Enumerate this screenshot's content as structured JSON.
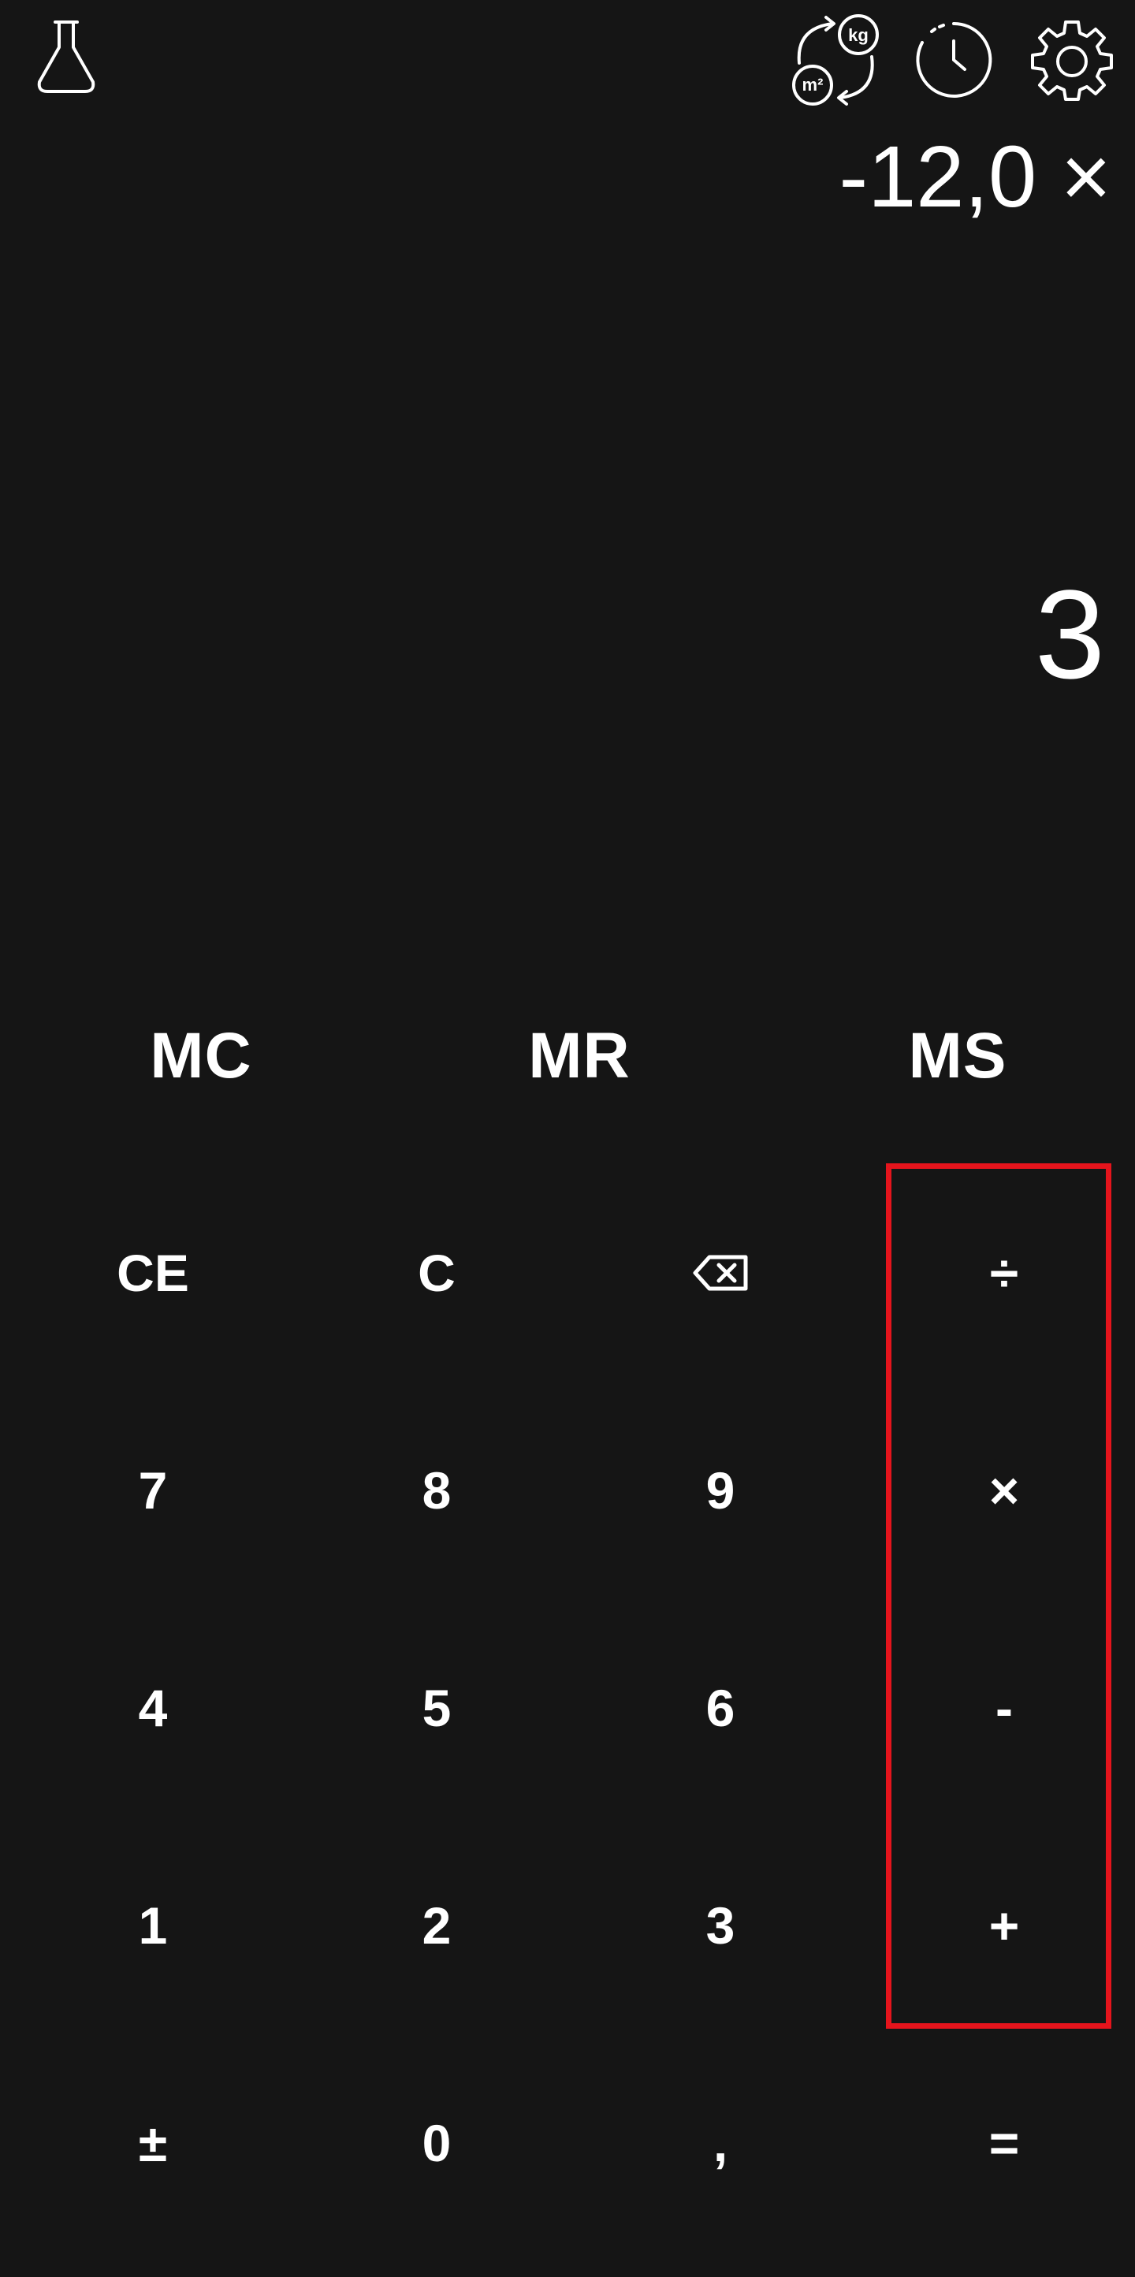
{
  "topbar": {
    "icons": [
      "flask-icon",
      "unit-converter-icon",
      "history-clock-icon",
      "settings-gear-icon"
    ],
    "unit_converter_labels": {
      "top": "kg",
      "bottom": "m²"
    }
  },
  "display": {
    "expression": "-12,0 ×",
    "result": "3"
  },
  "memory": {
    "mc": "MC",
    "mr": "MR",
    "ms": "MS"
  },
  "keys": {
    "ce": "CE",
    "c": "C",
    "backspace": "backspace-icon",
    "divide": "÷",
    "k7": "7",
    "k8": "8",
    "k9": "9",
    "multiply": "×",
    "k4": "4",
    "k5": "5",
    "k6": "6",
    "minus": "-",
    "k1": "1",
    "k2": "2",
    "k3": "3",
    "plus": "+",
    "plusminus": "±",
    "k0": "0",
    "comma": ",",
    "equals": "="
  },
  "colors": {
    "background": "#151515",
    "text": "#ffffff",
    "highlight": "#e5141c"
  }
}
